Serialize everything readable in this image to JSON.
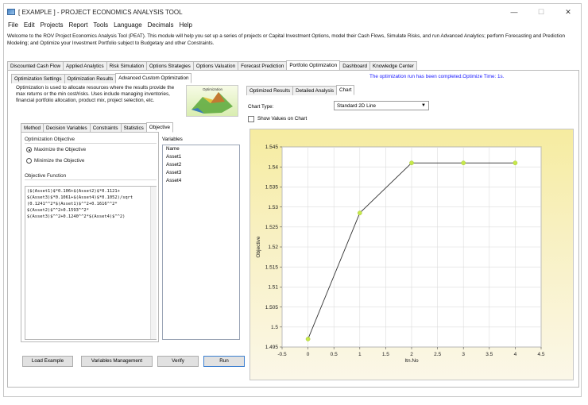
{
  "window": {
    "title": "[ EXAMPLE ] - PROJECT ECONOMICS ANALYSIS TOOL",
    "minimize": "—",
    "maximize": "☐",
    "close": "✕"
  },
  "menu": [
    "File",
    "Edit",
    "Projects",
    "Report",
    "Tools",
    "Language",
    "Decimals",
    "Help"
  ],
  "welcome": "Welcome to the ROV Project Economics Analysis Tool (PEAT). This module will help you set up a series of projects or Capital Investment Options, model their Cash Flows, Simulate Risks, and run Advanced Analytics; perform Forecasting and Prediction Modeling; and Optimize your Investment Portfolio subject to Budgetary and other Constraints.",
  "main_tabs": [
    "Discounted Cash Flow",
    "Applied Analytics",
    "Risk Simulation",
    "Options Strategies",
    "Options Valuation",
    "Forecast Prediction",
    "Portfolio Optimization",
    "Dashboard",
    "Knowledge Center"
  ],
  "main_tab_active": "Portfolio Optimization",
  "sub_tabs": [
    "Optimization Settings",
    "Optimization Results",
    "Advanced Custom Optimization"
  ],
  "status_message": "The optimization run has been completed.Optimize Time: 1s.",
  "description": "Optimization is used to allocate resources where the results provide the max returns or the min cost/risks. Uses include managing inventories, financial portfolio allocation, product mix, project selection, etc.",
  "thumbnail_label": "Optimization",
  "inner_tabs": [
    "Method",
    "Decision Variables",
    "Constraints",
    "Statistics",
    "Objective"
  ],
  "objective": {
    "section_label": "Optimization Objective",
    "maximize_label": "Maximize the Objective",
    "minimize_label": "Minimize the Objective",
    "selected": "maximize",
    "function_label": "Objective Function",
    "function_text": "($(Asset1)$*0.106+$(Asset2)$*0.1121+\n$(Asset3)$*0.1061+$(Asset4)$*0.1052)/sqrt\n(0.1241^^2*$(Asset1)$^^2+0.1616^^2*\n$(Asset2)$^^2+0.1593^^2*\n$(Asset3)$^^2+0.1240^^2*$(Asset4)$^^2)"
  },
  "variables": {
    "label": "Variables",
    "header": "Name",
    "items": [
      "Asset1",
      "Asset2",
      "Asset3",
      "Asset4"
    ]
  },
  "buttons": {
    "load_example": "Load Example",
    "variables_management": "Variables Management",
    "verify": "Verify",
    "run": "Run"
  },
  "result_tabs": [
    "Optimized Results",
    "Detailed Analysis",
    "Chart"
  ],
  "chart_controls": {
    "chart_type_label": "Chart Type:",
    "chart_type_value": "Standard 2D Line",
    "show_values_label": "Show Values on Chart",
    "show_values_checked": false
  },
  "chart_data": {
    "type": "line",
    "x": [
      0,
      1,
      2,
      3,
      4
    ],
    "values": [
      1.497,
      1.5285,
      1.541,
      1.541,
      1.541
    ],
    "xlabel": "Itn.No",
    "ylabel": "Objective",
    "xlim": [
      -0.5,
      4.5
    ],
    "ylim": [
      1.495,
      1.545
    ],
    "x_ticks": [
      "-0.5",
      "0",
      "0.5",
      "1",
      "1.5",
      "2",
      "2.5",
      "3",
      "3.5",
      "4",
      "4.5"
    ],
    "y_ticks": [
      "1.495",
      "1.5",
      "1.505",
      "1.51",
      "1.515",
      "1.52",
      "1.525",
      "1.53",
      "1.535",
      "1.54",
      "1.545"
    ],
    "x_tick_values": [
      -0.5,
      0,
      0.5,
      1,
      1.5,
      2,
      2.5,
      3,
      3.5,
      4,
      4.5
    ],
    "y_tick_values": [
      1.495,
      1.5,
      1.505,
      1.51,
      1.515,
      1.52,
      1.525,
      1.53,
      1.535,
      1.54,
      1.545
    ],
    "grid": true,
    "line_color": "#333333",
    "marker_color": "#c6e84a"
  }
}
